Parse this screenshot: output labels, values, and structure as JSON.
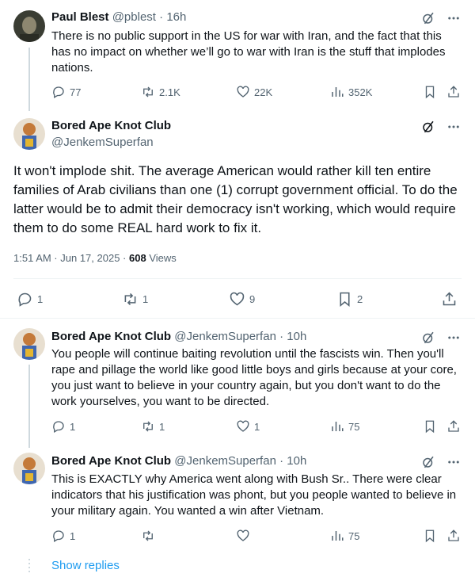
{
  "post1": {
    "name": "Paul Blest",
    "handle": "@pblest",
    "sep": "·",
    "time": "16h",
    "text": "There is no public support in the US for war with Iran, and the fact that this has no impact on whether we’ll go to war with Iran is the stuff that implodes nations.",
    "replies": "77",
    "reposts": "2.1K",
    "likes": "22K",
    "views": "352K"
  },
  "focused": {
    "name": "Bored Ape Knot Club",
    "handle": "@JenkemSuperfan",
    "text": "It won't implode shit. The average American would rather kill ten entire families of Arab civilians than one (1) corrupt government official. To do the latter would be to admit their democracy isn't working, which would require them to do some REAL hard work to fix it.",
    "date": "1:51 AM · Jun 17, 2025",
    "dot": " · ",
    "views_count": "608",
    "views_label": " Views",
    "replies": "1",
    "reposts": "1",
    "likes": "9",
    "bookmarks": "2"
  },
  "reply1": {
    "name": "Bored Ape Knot Club",
    "handle": "@JenkemSuperfan",
    "sep": "·",
    "time": "10h",
    "text": "You people will continue baiting revolution until the fascists win. Then you'll rape and pillage the world like good little boys and girls because at your core, you just want to believe in your country again, but you don't want to do the work yourselves, you want to be directed.",
    "replies": "1",
    "reposts": "1",
    "likes": "1",
    "views": "75"
  },
  "reply2": {
    "name": "Bored Ape Knot Club",
    "handle": "@JenkemSuperfan",
    "sep": "·",
    "time": "10h",
    "text": "This is EXACTLY why America went along with Bush Sr.. There were clear indicators that his justification was phont, but you people wanted to believe in your military again. You wanted a win after Vietnam.",
    "replies": "1",
    "views": "75"
  },
  "show_replies": "Show replies",
  "colors": {
    "accent": "#1d9bf0",
    "muted": "#536471",
    "text": "#0f1419"
  },
  "icons": [
    "grok-icon",
    "more-icon",
    "reply-icon",
    "repost-icon",
    "like-icon",
    "views-icon",
    "bookmark-icon",
    "share-icon"
  ]
}
